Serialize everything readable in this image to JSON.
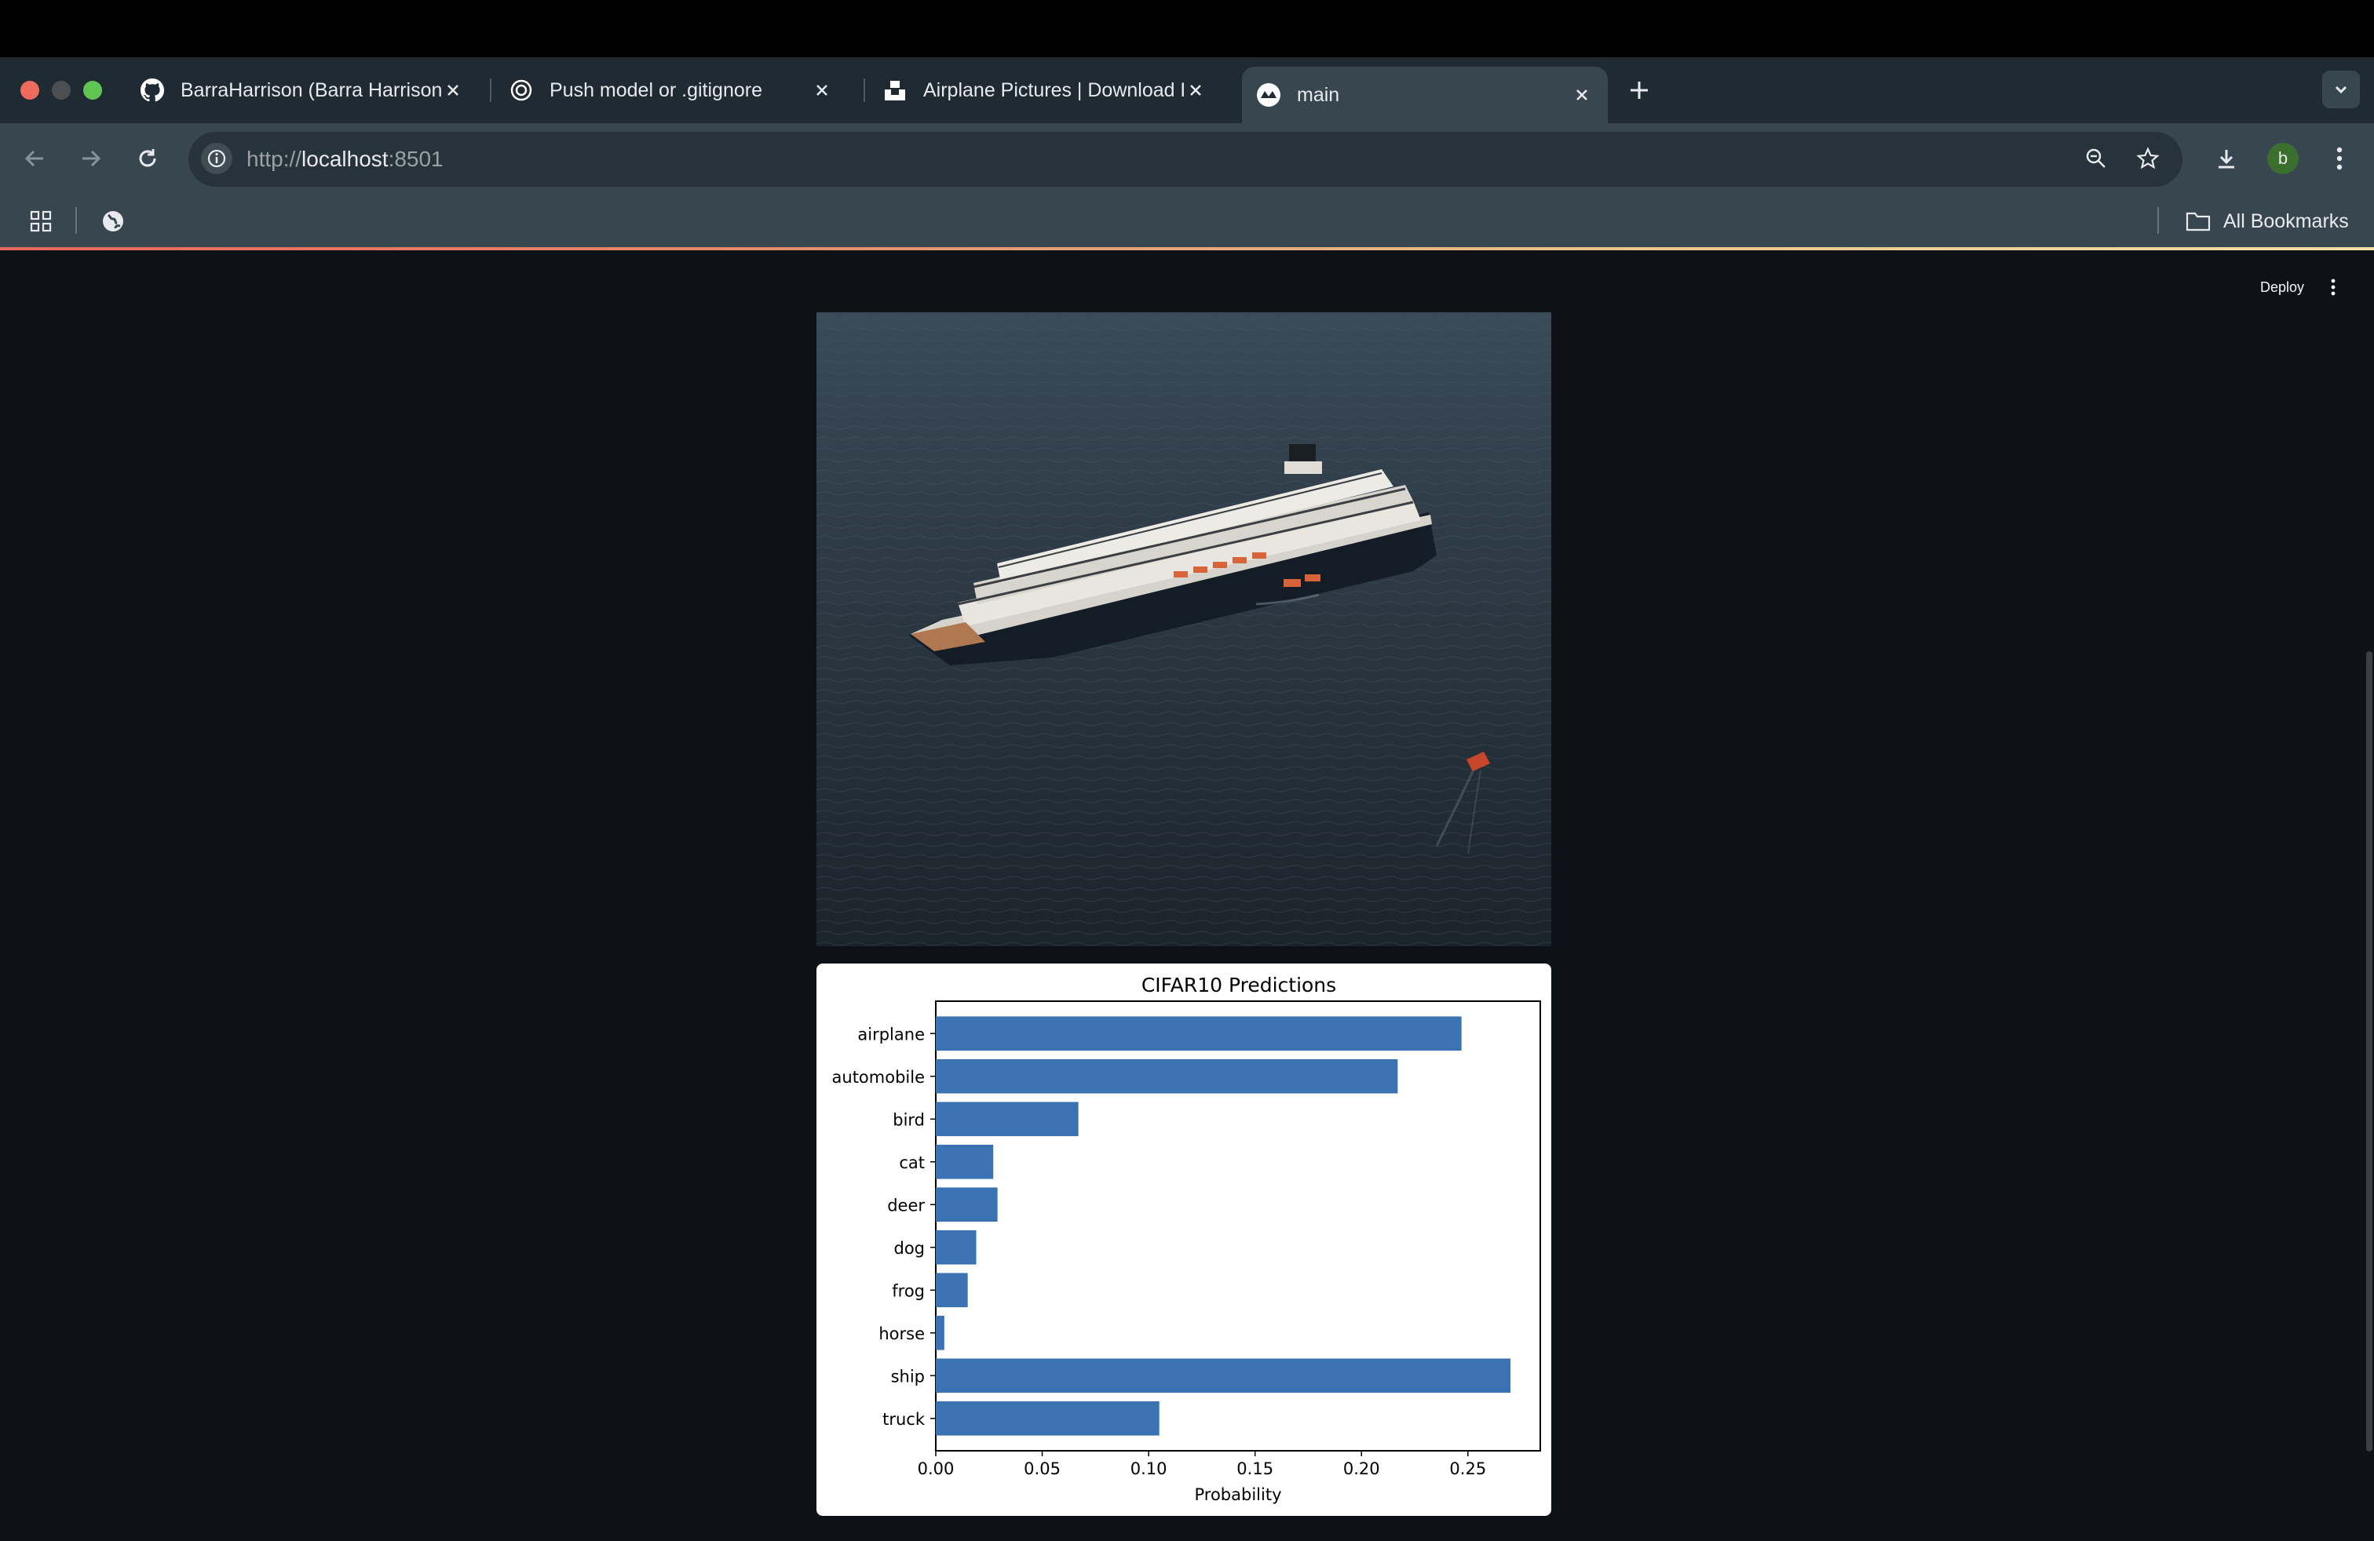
{
  "browser": {
    "tabs": [
      {
        "title": "BarraHarrison (Barra Harrison)",
        "icon": "github-icon",
        "active": false
      },
      {
        "title": "Push model or .gitignore",
        "icon": "openai-icon",
        "active": false
      },
      {
        "title": "Airplane Pictures | Download Free Images on Unsplash",
        "icon": "unsplash-icon",
        "active": false
      },
      {
        "title": "main",
        "icon": "streamlit-icon",
        "active": true
      }
    ],
    "url_prefix": "http://",
    "url_host": "localhost",
    "url_suffix": ":8501",
    "profile_initial": "b",
    "bookmarks_label": "All Bookmarks"
  },
  "app": {
    "deploy_label": "Deploy"
  },
  "chart_data": {
    "type": "bar",
    "orientation": "horizontal",
    "title": "CIFAR10 Predictions",
    "xlabel": "Probability",
    "ylabel": "",
    "categories": [
      "airplane",
      "automobile",
      "bird",
      "cat",
      "deer",
      "dog",
      "frog",
      "horse",
      "ship",
      "truck"
    ],
    "values": [
      0.247,
      0.217,
      0.067,
      0.027,
      0.029,
      0.019,
      0.015,
      0.004,
      0.27,
      0.105
    ],
    "xlim": [
      0,
      0.284
    ],
    "xticks": [
      "0.00",
      "0.05",
      "0.10",
      "0.15",
      "0.20",
      "0.25"
    ],
    "xtick_values": [
      0,
      0.05,
      0.1,
      0.15,
      0.2,
      0.25
    ],
    "bar_color": "#3a72b2",
    "grid": false
  }
}
